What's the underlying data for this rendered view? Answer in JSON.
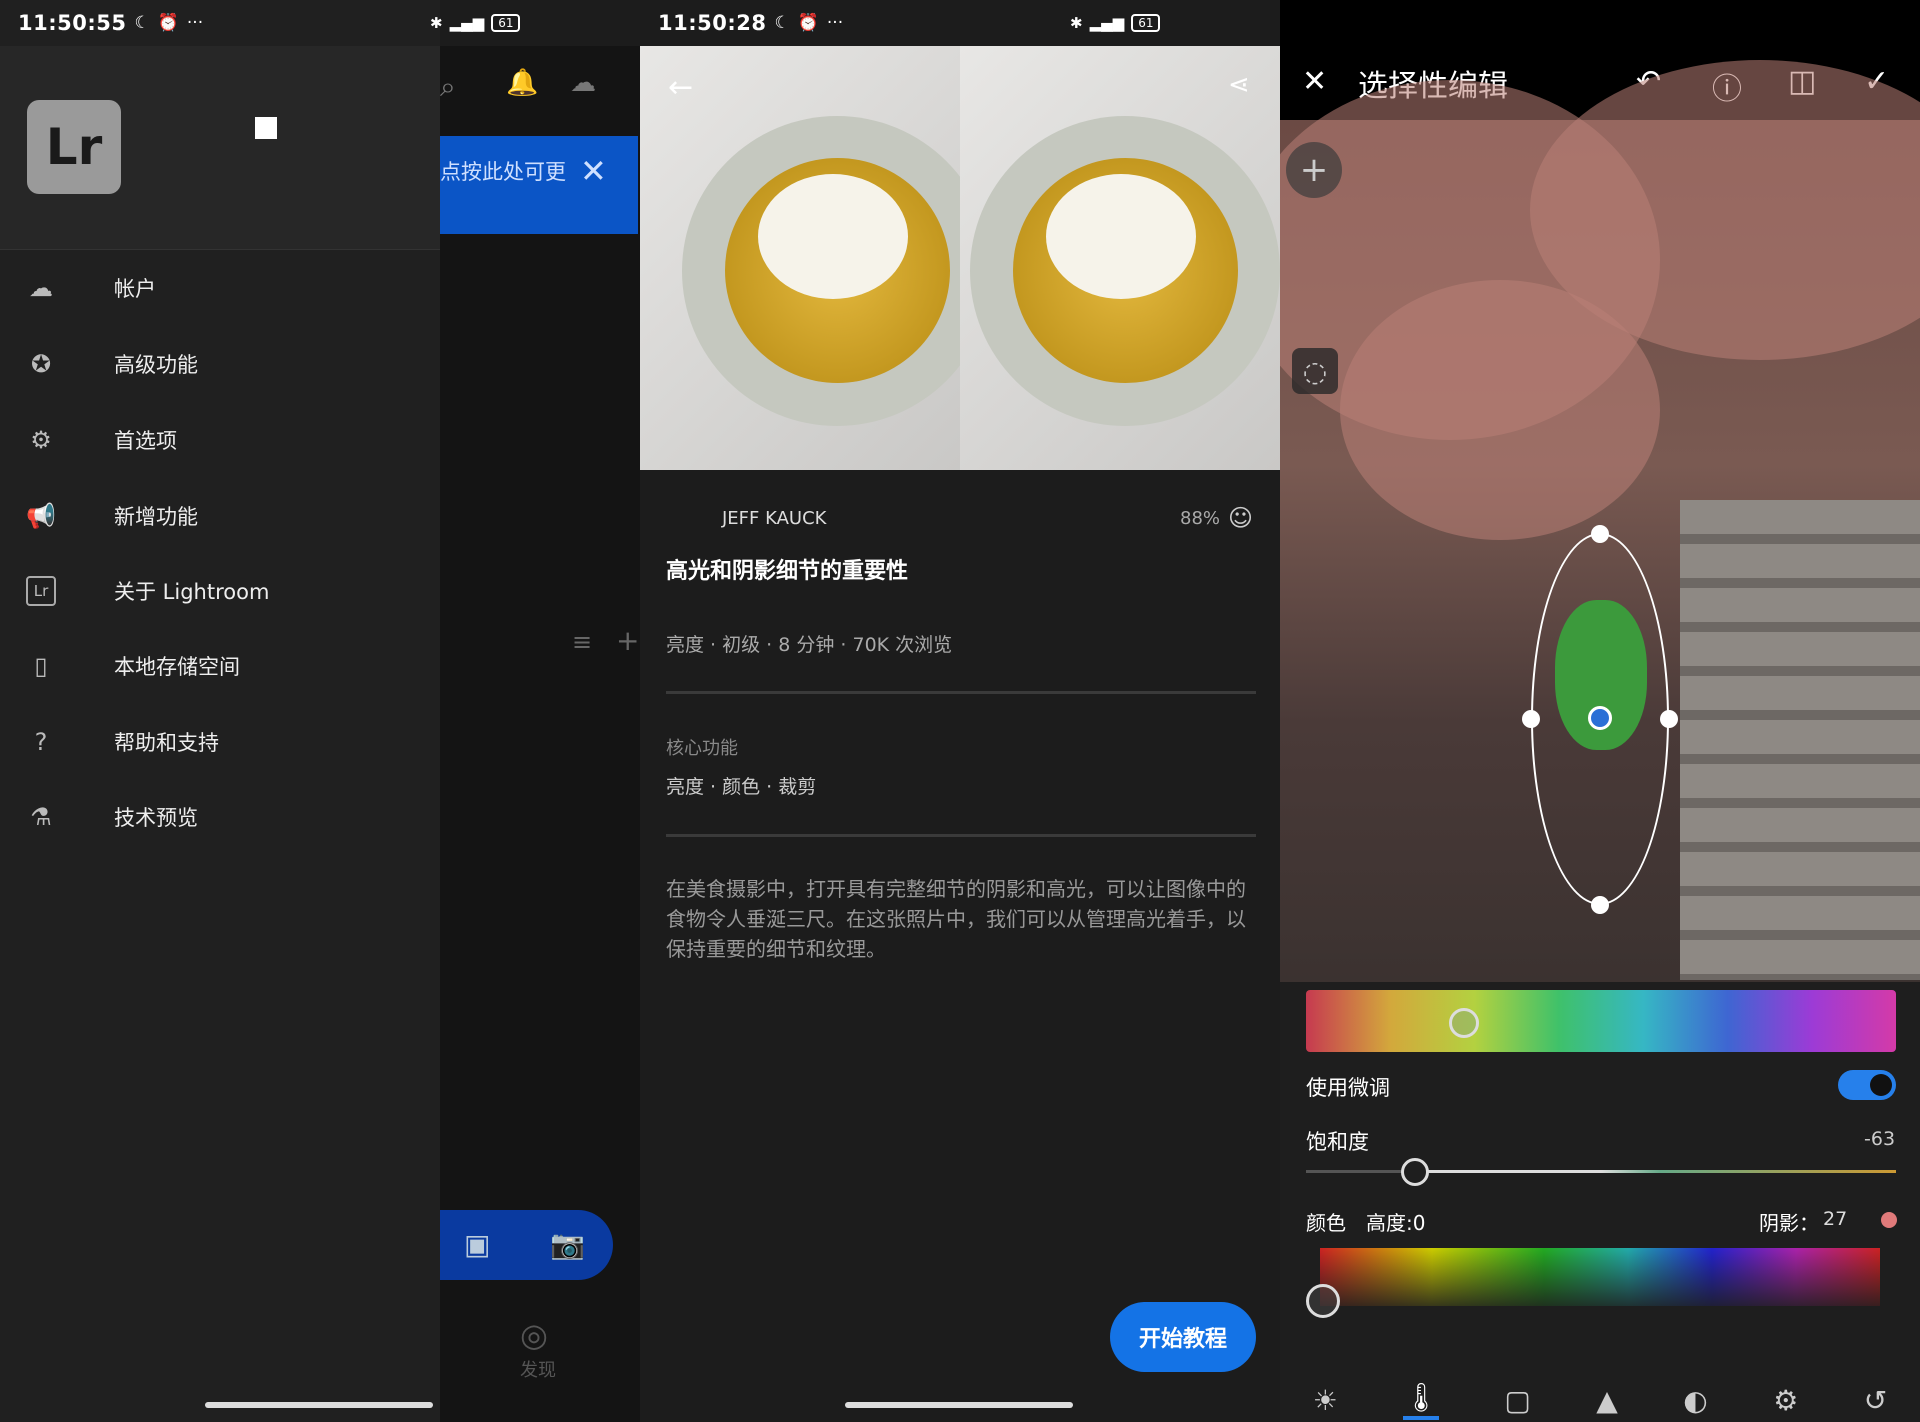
{
  "screen1": {
    "status": {
      "time": "11:50:55",
      "dots": "···",
      "battery": "61"
    },
    "drawer": {
      "logo": "Lr",
      "items": [
        {
          "icon": "cloud-icon",
          "label": "帐户"
        },
        {
          "icon": "star-icon",
          "label": "高级功能"
        },
        {
          "icon": "gear-icon",
          "label": "首选项"
        },
        {
          "icon": "megaphone-icon",
          "label": "新增功能"
        },
        {
          "icon": "lr-icon",
          "label": "关于 Lightroom"
        },
        {
          "icon": "phone-icon",
          "label": "本地存储空间"
        },
        {
          "icon": "help-icon",
          "label": "帮助和支持"
        },
        {
          "icon": "flask-icon",
          "label": "技术预览"
        }
      ]
    },
    "background": {
      "banner_text": "点按此处可更",
      "discover_label": "发现"
    }
  },
  "screen2": {
    "status": {
      "time": "11:50:28",
      "dots": "···",
      "battery": "61"
    },
    "author": "JEFF KAUCK",
    "rating": "88%",
    "title": "高光和阴影细节的重要性",
    "meta": "亮度 · 初级 · 8 分钟 · 70K 次浏览",
    "core_label": "核心功能",
    "core_items": "亮度 · 颜色 · 裁剪",
    "description": "在美食摄影中，打开具有完整细节的阴影和高光，可以让图像中的食物令人垂涎三尺。在这张照片中，我们可以从管理高光着手，以保持重要的细节和纹理。",
    "start_button": "开始教程"
  },
  "screen3": {
    "title": "选择性编辑",
    "fine_tune_label": "使用微调",
    "fine_tune_on": true,
    "saturation_label": "饱和度",
    "saturation_value": "-63",
    "color_label": "颜色",
    "brightness_label": "高度:0",
    "shadow_label": "阴影：",
    "shadow_value": "27",
    "accent": "#2680eb"
  }
}
